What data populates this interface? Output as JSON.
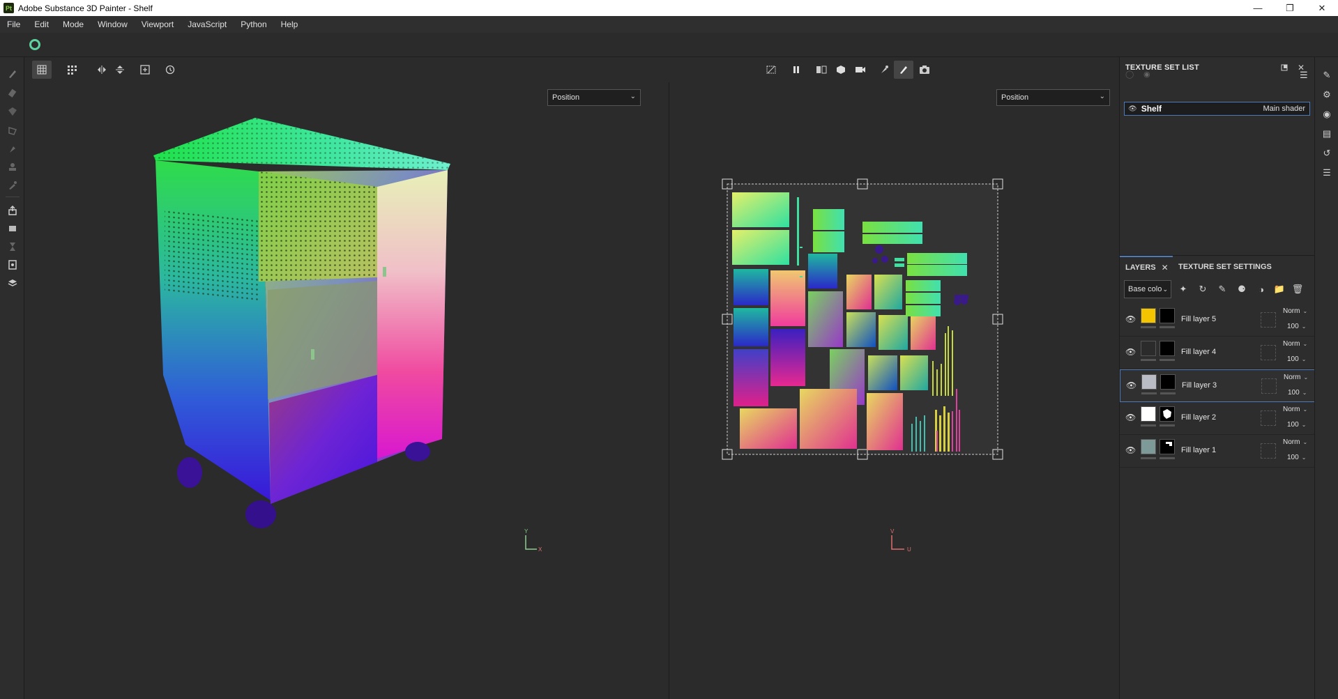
{
  "window": {
    "title": "Adobe Substance 3D Painter - Shelf",
    "logo_text": "Pt",
    "minimize_label": "—",
    "maximize_label": "❐",
    "close_label": "✕"
  },
  "menu": [
    "File",
    "Edit",
    "Mode",
    "Window",
    "Viewport",
    "JavaScript",
    "Python",
    "Help"
  ],
  "viewport_3d": {
    "channel": "Position",
    "axis_y": "Y",
    "axis_x": "X"
  },
  "viewport_2d": {
    "channel": "Position",
    "axis_v": "V",
    "axis_u": "U"
  },
  "texture_set_list": {
    "title": "TEXTURE SET LIST",
    "items": [
      {
        "name": "Shelf",
        "shader": "Main shader"
      }
    ]
  },
  "layers_panel": {
    "tabs": [
      {
        "label": "LAYERS"
      },
      {
        "label": "TEXTURE SET SETTINGS"
      }
    ],
    "channel": "Base colo",
    "layers": [
      {
        "name": "Fill layer 5",
        "blend": "Norm",
        "opacity": "100",
        "color": "#f5c400"
      },
      {
        "name": "Fill layer 4",
        "blend": "Norm",
        "opacity": "100",
        "color": "#2b2b2b"
      },
      {
        "name": "Fill layer 3",
        "blend": "Norm",
        "opacity": "100",
        "color": "#b9bcc4"
      },
      {
        "name": "Fill layer 2",
        "blend": "Norm",
        "opacity": "100",
        "color": "#ffffff"
      },
      {
        "name": "Fill layer 1",
        "blend": "Norm",
        "opacity": "100",
        "color": "#7d9a98"
      }
    ]
  },
  "icons": {
    "left_tools": [
      "paint-brush-icon",
      "eraser-icon",
      "projection-icon",
      "polygon-fill-icon",
      "smudge-icon",
      "clone-stamp-icon",
      "color-picker-icon",
      "export-icon",
      "bake-icon",
      "hourglass-icon",
      "report-icon",
      "shelf-icon"
    ],
    "viewport_tools": [
      "grid-view-icon",
      "multi-grid-icon",
      "symmetry-icon",
      "mirror-icon",
      "frame-icon",
      "history-icon"
    ],
    "right_strip": [
      "brush-panel-icon",
      "settings-panel-icon",
      "display-settings-icon",
      "shelf-panel-icon",
      "history-panel-icon",
      "log-panel-icon"
    ]
  }
}
